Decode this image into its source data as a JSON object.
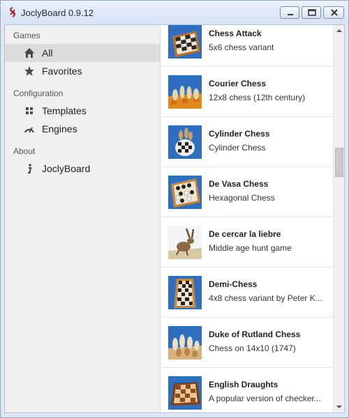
{
  "window": {
    "title": "JoclyBoard 0.9.12",
    "icon": "jocly-knot-icon"
  },
  "sidebar": {
    "sections": [
      {
        "header": "Games",
        "items": [
          {
            "label": "All",
            "icon": "home-icon",
            "active": true
          },
          {
            "label": "Favorites",
            "icon": "star-icon",
            "active": false
          }
        ]
      },
      {
        "header": "Configuration",
        "items": [
          {
            "label": "Templates",
            "icon": "grid-icon",
            "active": false
          },
          {
            "label": "Engines",
            "icon": "gauge-icon",
            "active": false
          }
        ]
      },
      {
        "header": "About",
        "items": [
          {
            "label": "JoclyBoard",
            "icon": "info-icon",
            "active": false
          }
        ]
      }
    ]
  },
  "games": [
    {
      "name": "Chess Attack",
      "description": "5x6 chess variant",
      "thumb": "chessboard-thumbnail"
    },
    {
      "name": "Courier Chess",
      "description": "12x8 chess (12th century)",
      "thumb": "chess-pieces-thumbnail"
    },
    {
      "name": "Cylinder Chess",
      "description": "Cylinder Chess",
      "thumb": "cylinder-board-thumbnail"
    },
    {
      "name": "De Vasa Chess",
      "description": "Hexagonal Chess",
      "thumb": "hex-board-thumbnail"
    },
    {
      "name": "De cercar la liebre",
      "description": "Middle age hunt game",
      "thumb": "hare-thumbnail"
    },
    {
      "name": "Demi-Chess",
      "description": "4x8 chess variant by Peter K...",
      "thumb": "narrow-board-thumbnail"
    },
    {
      "name": "Duke of Rutland Chess",
      "description": "Chess on 14x10 (1747)",
      "thumb": "chess-pieces-thumbnail"
    },
    {
      "name": "English Draughts",
      "description": "A popular version of checker...",
      "thumb": "draughts-board-thumbnail"
    }
  ],
  "colors": {
    "sky_blue": "#2e6fc0",
    "board_wood": "#c8873a",
    "sidebar_bg": "#f0f0f0",
    "active_item": "#dcdcdc"
  }
}
